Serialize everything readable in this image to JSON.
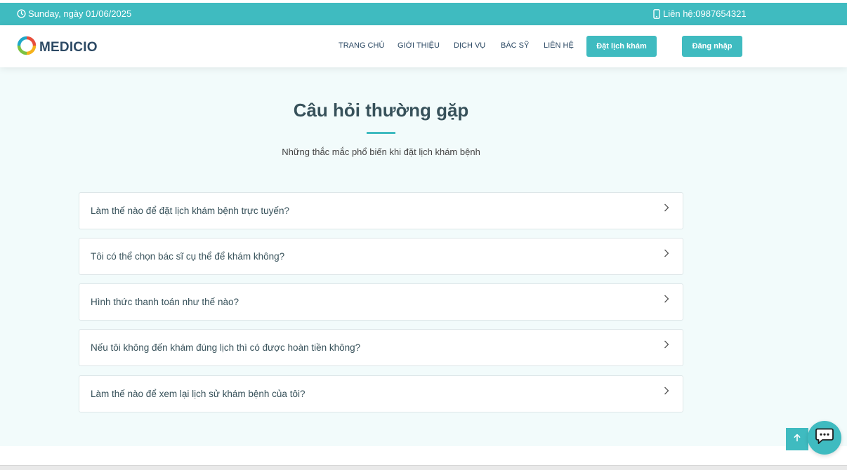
{
  "topbar": {
    "date": "Sunday, ngày 01/06/2025",
    "contact": "Liên hệ:0987654321"
  },
  "header": {
    "logo": "MEDICIO",
    "nav": [
      "TRANG CHỦ",
      "GIỚI THIỆU",
      "DỊCH VỤ",
      "BÁC SỸ",
      "LIÊN HỆ"
    ],
    "book_button": "Đặt lịch khám",
    "login_button": "Đăng nhập"
  },
  "section": {
    "title": "Câu hỏi thường gặp",
    "subtitle": "Những thắc mắc phổ biến khi đặt lịch khám bệnh"
  },
  "faq": [
    "Làm thế nào để đặt lịch khám bệnh trực tuyến?",
    "Tôi có thể chọn bác sĩ cụ thể để khám không?",
    "Hình thức thanh toán như thế nào?",
    "Nếu tôi không đến khám đúng lịch thì có được hoàn tiền không?",
    "Làm thế nào để xem lại lịch sử khám bệnh của tôi?"
  ],
  "colors": {
    "accent": "#3fbbc0",
    "heading": "#37515a",
    "section_bg": "#f2fbfb"
  },
  "icons": {
    "date": "clock-icon",
    "contact": "phone-icon",
    "faq": "chevron-right-icon",
    "back_to_top": "arrow-up-icon",
    "chat": "chat-icon"
  }
}
